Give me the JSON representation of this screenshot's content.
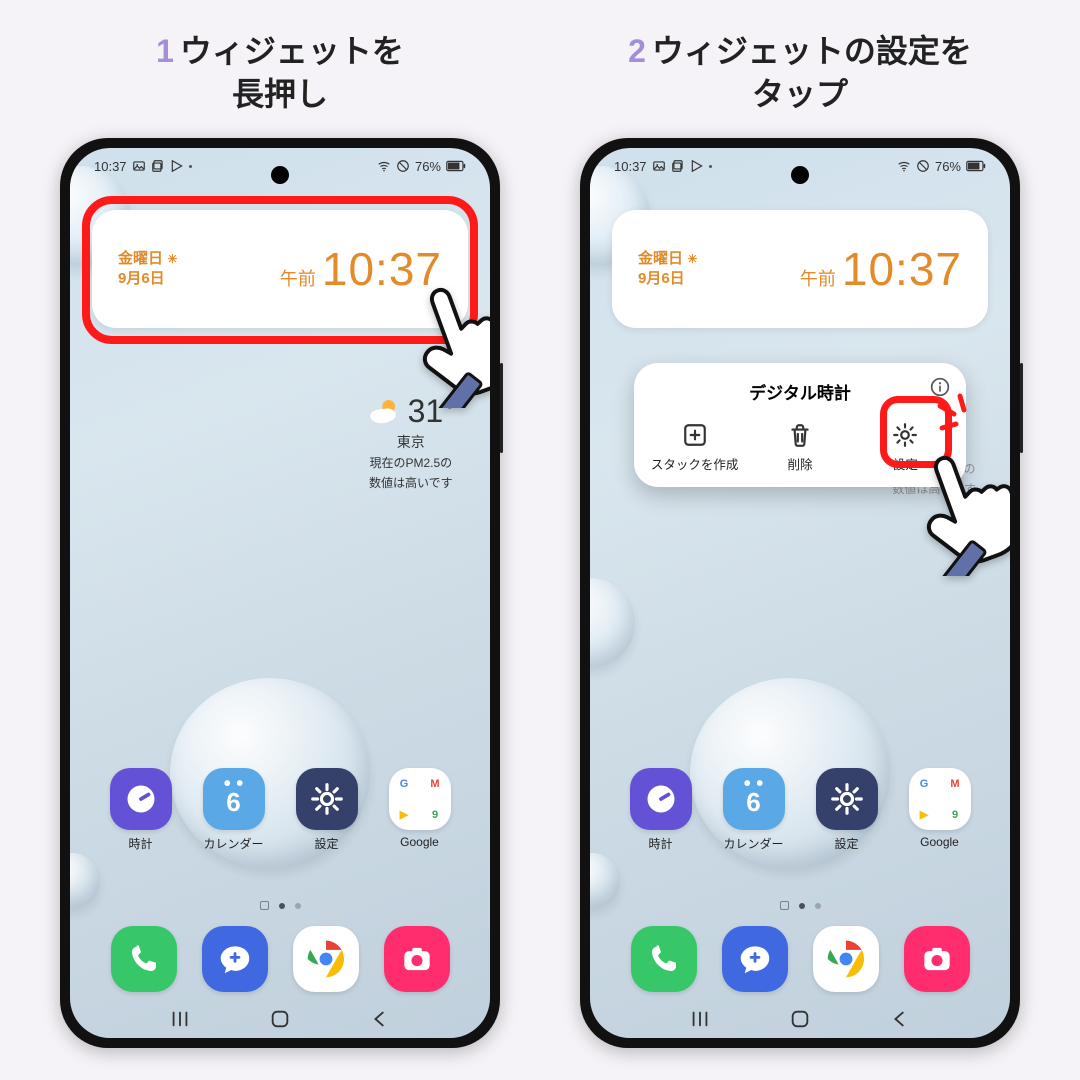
{
  "steps": [
    {
      "num": "1",
      "title_l1": "ウィジェットを",
      "title_l2": "長押し"
    },
    {
      "num": "2",
      "title_l1": "ウィジェットの設定を",
      "title_l2": "タップ"
    }
  ],
  "status": {
    "time": "10:37",
    "battery": "76%"
  },
  "widget": {
    "day": "金曜日",
    "date": "9月6日",
    "ampm": "午前",
    "time": "10:37"
  },
  "weather": {
    "temp": "31°",
    "city": "東京",
    "line1": "現在のPM2.5の",
    "line2": "数値は高いです"
  },
  "apps": {
    "clock": "時計",
    "calendar": "カレンダー",
    "calendar_day": "6",
    "settings": "設定",
    "google": "Google"
  },
  "popup": {
    "title": "デジタル時計",
    "stack": "スタックを作成",
    "delete": "削除",
    "settings": "設定"
  }
}
